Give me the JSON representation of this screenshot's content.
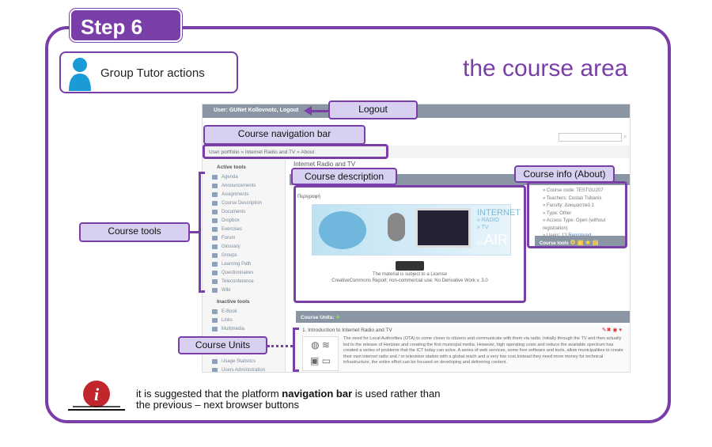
{
  "slide": {
    "step": "Step 6",
    "role": "Group Tutor actions",
    "title": "the course area",
    "note": {
      "before": "it is suggested that the platform ",
      "bold": "navigation bar",
      "after": " is used rather than",
      "line2": "the previous – next browser buttons"
    }
  },
  "callouts": {
    "logout": "Logout",
    "nav": "Course navigation bar",
    "desc": "Course description",
    "info": "Course info (About)",
    "tools": "Course tools",
    "units": "Course Units"
  },
  "app": {
    "user_bar": "User: GUNet Kollovnotc, Logout",
    "breadcrumb": "User portfolio » Internet Radio and TV » About",
    "course_title": "Internet Radio and TV",
    "sidebar": {
      "active_header": "Active tools",
      "active": [
        "Agenda",
        "Announcements",
        "Assignments",
        "Course Description",
        "Documents",
        "Dropbox",
        "Exercises",
        "Forum",
        "Glossary",
        "Groups",
        "Learning Path",
        "Questionnaires",
        "Teleconference",
        "Wiki"
      ],
      "inactive_header": "Inactive tools",
      "inactive": [
        "E-Book",
        "Links",
        "Multimedia"
      ],
      "admin_header": "Administration tools",
      "admin": [
        "Usage Statistics",
        "Users Administration"
      ]
    },
    "description": {
      "heading": "Περιγραφή",
      "banner_text": [
        "INTERNET",
        "» RADIO",
        "» TV",
        "ON",
        "AIR"
      ],
      "license_line1": "The material is subject to a License",
      "license_line2": "CreativeCommons Report; non-commercial use; No Derivative Work v. 3.0"
    },
    "info": {
      "items": [
        "Course code: TESTGU207",
        "Teachers: Costas Tsibanis",
        "Faculty: Δοκιμαστικό 1",
        "Type: Other",
        "Access Type: Open (without registration)"
      ],
      "users_label": "Users:",
      "users_value": "13 Registered",
      "tools_label": "Course tools"
    },
    "units": {
      "header": "Course Units:",
      "unit_title": "1.  Introduction to Internet Radio and TV",
      "unit_body": "The need for Local Authorities (OTA) to come closer to citizens and communicate with them via radio. Initially through the TV and then actually led to the release of Hertzian and creating the first municipal media. However, high operating costs and reduce the available spectrum has created a series of problems that the ICT today can solve. A series of web services, some free software and tools, allow municipalities to create their own internet radio and / or television station with a global reach and a very low cost.Instead they need more money for technical infrastructure, the entire effort can be focused on developing and delivering content."
    }
  },
  "colors": {
    "accent": "#7a3ea8",
    "callout": "#d8d0f0",
    "bar": "#8a96a3"
  }
}
